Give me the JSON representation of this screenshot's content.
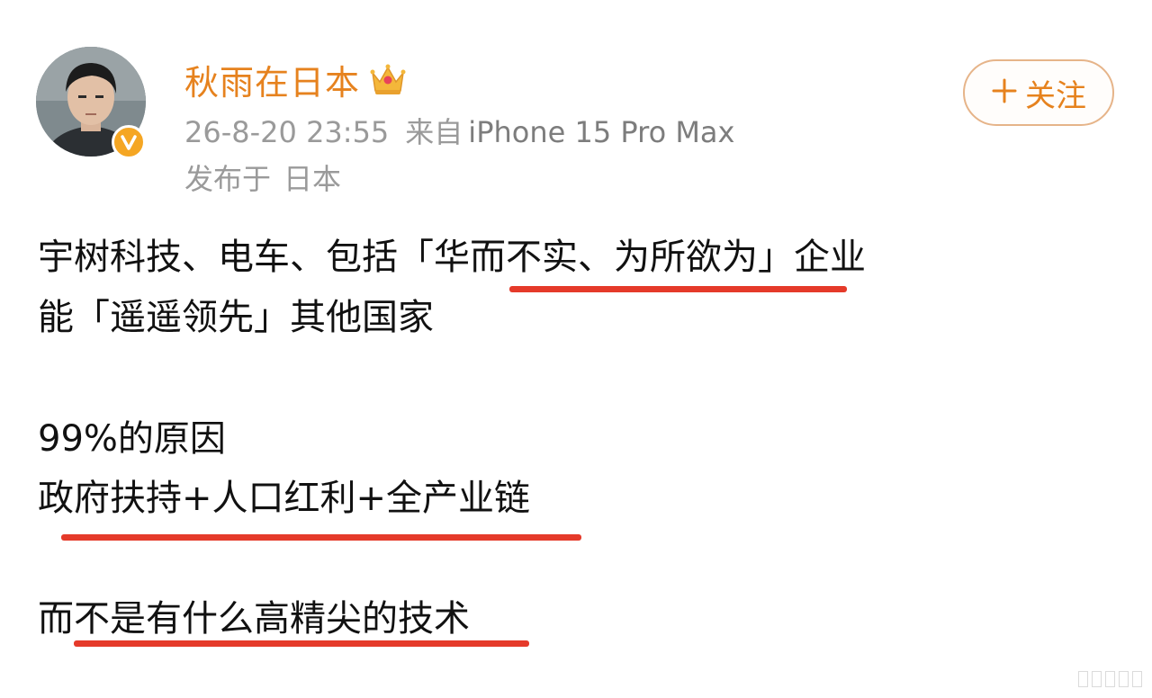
{
  "post": {
    "author": {
      "name": "秋雨在日本",
      "avatar_icon": "person-photo",
      "verified_icon": "verified-v-badge",
      "crown_icon": "vip-crown"
    },
    "timestamp": "26-8-20 23:55",
    "source_label": "来自",
    "device": "iPhone 15 Pro Max",
    "location_label": "发布于",
    "location": "日本",
    "follow_button": {
      "icon": "plus",
      "label": "关注"
    },
    "body": {
      "line1": "宇树科技、电车、包括「华而不实、为所欲为」企业",
      "line2": "能「遥遥领先」其他国家",
      "line3": "99%的原因",
      "line4": "政府扶持+人口红利+全产业链",
      "line5": "而不是有什么高精尖的技术"
    }
  },
  "colors": {
    "accent": "#e6821e",
    "underline": "#e53a2a",
    "meta_text": "#9a9a9a",
    "body_text": "#111111",
    "verified": "#f5a623"
  }
}
